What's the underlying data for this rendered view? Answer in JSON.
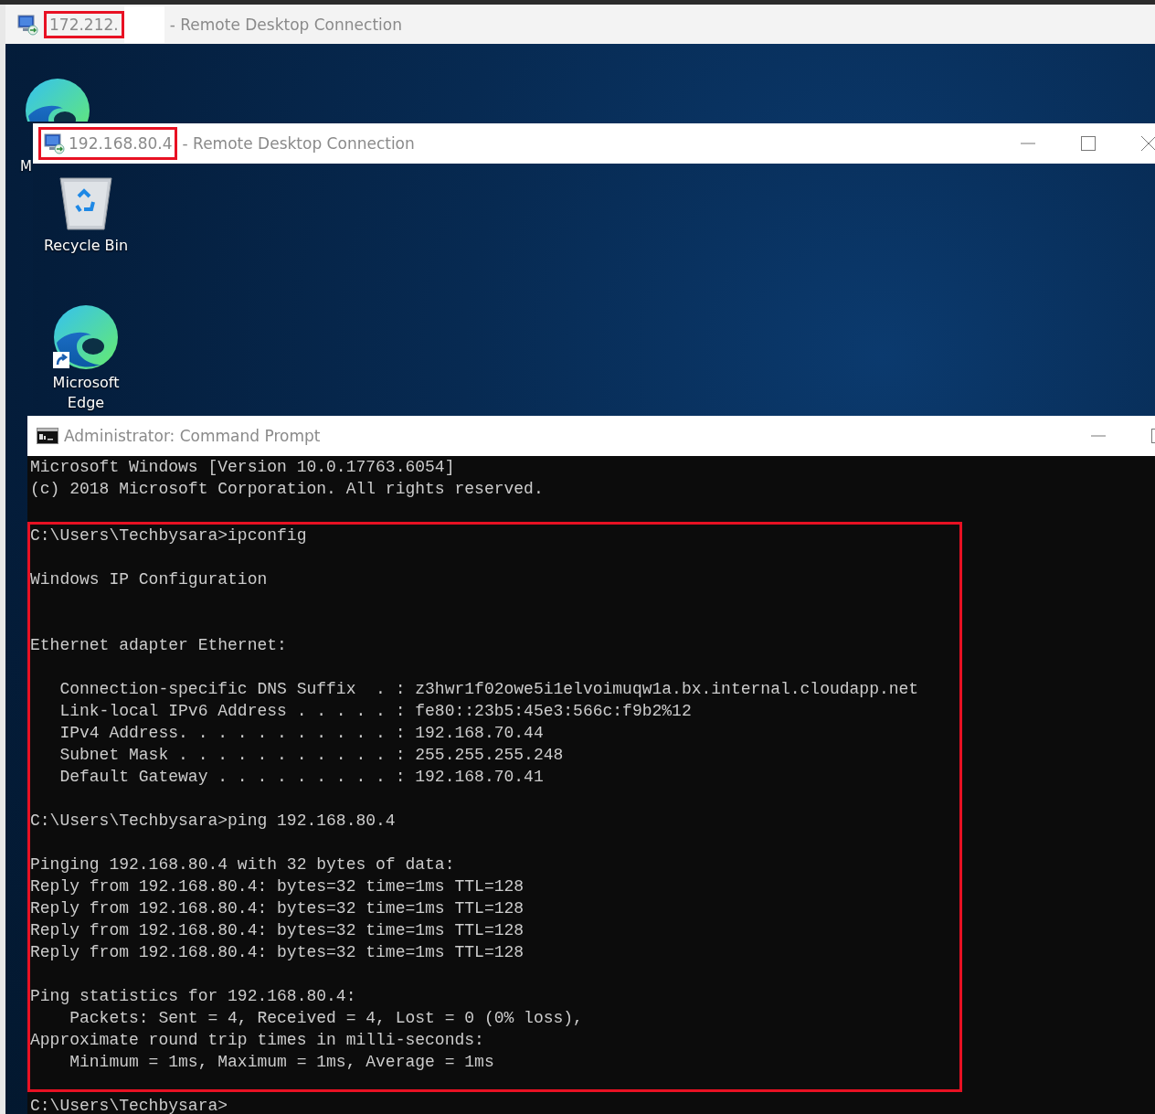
{
  "outer_window": {
    "title_address": "172.212.",
    "address_highlighted": true,
    "redacted": true,
    "title": "- Remote Desktop Connection"
  },
  "outer_desktop": {
    "icons": [
      {
        "kind": "edge",
        "label": "M"
      }
    ]
  },
  "inner_window": {
    "title_address": "192.168.80.4",
    "address_highlighted": true,
    "title": "- Remote Desktop Connection"
  },
  "inner_desktop": {
    "icons": [
      {
        "kind": "recycle_bin",
        "label": "Recycle Bin"
      },
      {
        "kind": "edge",
        "label": "Microsoft Edge"
      }
    ]
  },
  "cmd_window": {
    "title": "Administrator: Command Prompt",
    "sections": [
      {
        "highlighted": false,
        "paragraphs": [
          {
            "lines": [
              "Microsoft Windows [Version 10.0.17763.6054]",
              "(c) 2018 Microsoft Corporation. All rights reserved."
            ]
          }
        ]
      },
      {
        "highlighted": true,
        "paragraphs": [
          {
            "lines": [
              "C:\\Users\\Techbysara>ipconfig"
            ]
          },
          {
            "lines": [
              "Windows IP Configuration"
            ]
          },
          {
            "kind": "adapter_heading",
            "lines": [
              "Ethernet adapter Ethernet:"
            ]
          },
          {
            "lines": [
              "   Connection-specific DNS Suffix  . : z3hwr1f02owe5i1elvoimuqw1a.bx.internal.cloudapp.net",
              "   Link-local IPv6 Address . . . . . : fe80::23b5:45e3:566c:f9b2%12",
              "   IPv4 Address. . . . . . . . . . . : 192.168.70.44",
              "   Subnet Mask . . . . . . . . . . . : 255.255.255.248",
              "   Default Gateway . . . . . . . . . : 192.168.70.41"
            ]
          },
          {
            "lines": [
              "C:\\Users\\Techbysara>ping 192.168.80.4"
            ]
          },
          {
            "lines": [
              "Pinging 192.168.80.4 with 32 bytes of data:",
              "Reply from 192.168.80.4: bytes=32 time=1ms TTL=128",
              "Reply from 192.168.80.4: bytes=32 time=1ms TTL=128",
              "Reply from 192.168.80.4: bytes=32 time=1ms TTL=128",
              "Reply from 192.168.80.4: bytes=32 time=1ms TTL=128"
            ]
          },
          {
            "lines": [
              "Ping statistics for 192.168.80.4:",
              "    Packets: Sent = 4, Received = 4, Lost = 0 (0% loss),",
              "Approximate round trip times in milli-seconds:",
              "    Minimum = 1ms, Maximum = 1ms, Average = 1ms"
            ]
          }
        ]
      },
      {
        "highlighted": false,
        "paragraphs": [
          {
            "lines": [
              "C:\\Users\\Techbysara>"
            ]
          }
        ]
      }
    ]
  }
}
